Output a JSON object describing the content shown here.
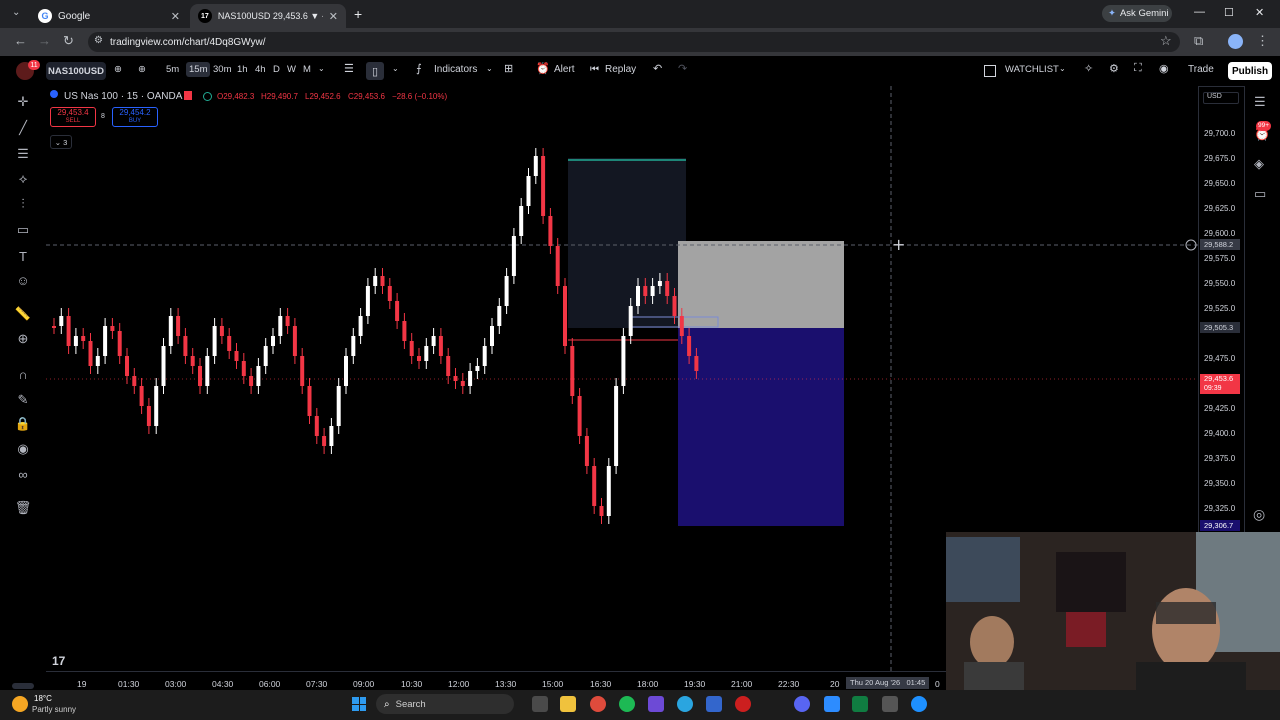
{
  "browser": {
    "tabs": [
      {
        "title": "Google",
        "active": false
      },
      {
        "title": "NAS100USD 29,453.6 ▼ -0.13%",
        "active": true
      }
    ],
    "url": "tradingview.com/chart/4Dq8GWyw/",
    "ask_gemini": "Ask Gemini"
  },
  "toolbar": {
    "notification_count": "11",
    "symbol": "NAS100USD",
    "timeframes": [
      "5m",
      "15m",
      "30m",
      "1h",
      "4h",
      "D",
      "W",
      "M"
    ],
    "active_timeframe": "15m",
    "indicators_label": "Indicators",
    "alert_label": "Alert",
    "replay_label": "Replay",
    "watchlist_label": "WATCHLIST",
    "trade_label": "Trade",
    "publish_label": "Publish"
  },
  "legend": {
    "title": "US Nas 100 · 15 · OANDA",
    "open": "O29,482.3",
    "high": "H29,490.7",
    "low": "L29,452.6",
    "close": "C29,453.6",
    "change": "−28.6 (−0.10%)",
    "sell_price": "29,453.4",
    "sell_label": "SELL",
    "spread": "8",
    "buy_price": "29,454.2",
    "buy_label": "BUY",
    "indicators_count": "3"
  },
  "price_axis": {
    "currency": "USD",
    "labels": [
      "29,700.0",
      "29,675.0",
      "29,650.0",
      "29,625.0",
      "29,600.0",
      "29,575.0",
      "29,550.0",
      "29,525.0",
      "29,475.0",
      "29,425.0",
      "29,400.0",
      "29,375.0",
      "29,350.0",
      "29,325.0"
    ],
    "crosshair_price": "29,588.2",
    "entry_price": "29,505.3",
    "current_price": "29,453.6",
    "countdown": "09:39",
    "low_price": "29,306.7",
    "alert_badge": "99+"
  },
  "time_axis": {
    "labels": [
      "19",
      "01:30",
      "03:00",
      "04:30",
      "06:00",
      "07:30",
      "09:00",
      "10:30",
      "12:00",
      "13:30",
      "15:00",
      "16:30",
      "18:00",
      "19:30",
      "21:00",
      "22:30",
      "20"
    ],
    "crosshair_time": "Thu 20 Aug '26   01:45",
    "zero": "0"
  },
  "colors": {
    "up": "#ffffff",
    "down": "#f23645",
    "profit_zone": "#1a0f6e",
    "loss_zone": "#a3a3a3",
    "accent": "#2962ff"
  },
  "taskbar": {
    "temperature": "18°C",
    "weather": "Partly sunny",
    "search_placeholder": "Search"
  }
}
